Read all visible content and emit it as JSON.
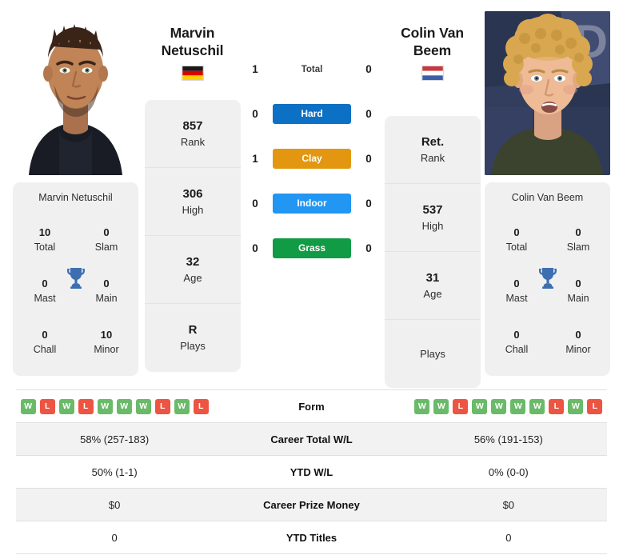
{
  "colors": {
    "win": "#6aba69",
    "loss": "#ee5442",
    "hard": "#0c70c4",
    "clay": "#e39710",
    "indoor": "#2196f3",
    "grass": "#119b45",
    "trophy": "#3d6fb0",
    "card_bg": "#f0f0f0",
    "row_alt": "#f2f2f2"
  },
  "players": {
    "left": {
      "name_line1": "Marvin",
      "name_line2": "Netuschil",
      "full_name": "Marvin Netuschil",
      "country_flag": "germany-flag",
      "photo": "player-photo-marvin-netuschil",
      "rank": {
        "value": "857",
        "label": "Rank"
      },
      "high": {
        "value": "306",
        "label": "High"
      },
      "age": {
        "value": "32",
        "label": "Age"
      },
      "plays": {
        "value": "R",
        "label": "Plays"
      },
      "titles": [
        {
          "value": "10",
          "label": "Total"
        },
        {
          "value": "0",
          "label": "Slam"
        },
        {
          "value": "0",
          "label": "Mast"
        },
        {
          "value": "0",
          "label": "Main"
        },
        {
          "value": "0",
          "label": "Chall"
        },
        {
          "value": "10",
          "label": "Minor"
        }
      ],
      "form": [
        "W",
        "L",
        "W",
        "L",
        "W",
        "W",
        "W",
        "L",
        "W",
        "L"
      ],
      "career_total_wl": "58% (257-183)",
      "ytd_wl": "50% (1-1)",
      "career_prize_money": "$0",
      "ytd_titles": "0"
    },
    "right": {
      "name_line1": "Colin Van",
      "name_line2": "Beem",
      "full_name": "Colin Van Beem",
      "country_flag": "netherlands-flag",
      "photo": "player-photo-colin-van-beem",
      "rank": {
        "value": "Ret.",
        "label": "Rank"
      },
      "high": {
        "value": "537",
        "label": "High"
      },
      "age": {
        "value": "31",
        "label": "Age"
      },
      "plays": {
        "value": "",
        "label": "Plays"
      },
      "titles": [
        {
          "value": "0",
          "label": "Total"
        },
        {
          "value": "0",
          "label": "Slam"
        },
        {
          "value": "0",
          "label": "Mast"
        },
        {
          "value": "0",
          "label": "Main"
        },
        {
          "value": "0",
          "label": "Chall"
        },
        {
          "value": "0",
          "label": "Minor"
        }
      ],
      "form": [
        "W",
        "W",
        "L",
        "W",
        "W",
        "W",
        "W",
        "L",
        "W",
        "L"
      ],
      "career_total_wl": "56% (191-153)",
      "ytd_wl": "0% (0-0)",
      "career_prize_money": "$0",
      "ytd_titles": "0"
    }
  },
  "h2h": {
    "total": {
      "label": "Total",
      "left": "1",
      "right": "0"
    },
    "surfaces": [
      {
        "label": "Hard",
        "left": "0",
        "right": "0",
        "color": "#0c70c4"
      },
      {
        "label": "Clay",
        "left": "1",
        "right": "0",
        "color": "#e39710"
      },
      {
        "label": "Indoor",
        "left": "0",
        "right": "0",
        "color": "#2196f3"
      },
      {
        "label": "Grass",
        "left": "0",
        "right": "0",
        "color": "#119b45"
      }
    ]
  },
  "stats_table": {
    "rows": [
      {
        "label": "Form",
        "left": "",
        "right": ""
      },
      {
        "label": "Career Total W/L",
        "left": "58% (257-183)",
        "right": "56% (191-153)"
      },
      {
        "label": "YTD W/L",
        "left": "50% (1-1)",
        "right": "0% (0-0)"
      },
      {
        "label": "Career Prize Money",
        "left": "$0",
        "right": "$0"
      },
      {
        "label": "YTD Titles",
        "left": "0",
        "right": "0"
      }
    ]
  }
}
